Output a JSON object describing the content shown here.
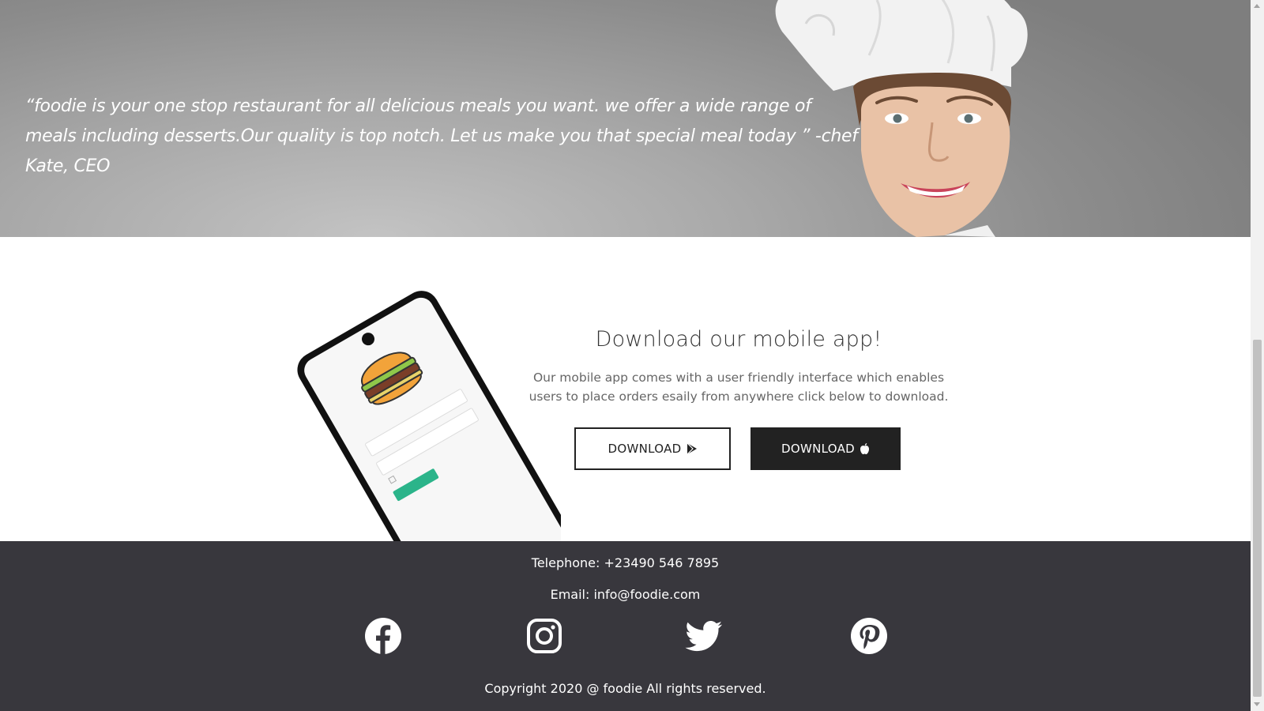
{
  "hero": {
    "quote": "“foodie is your one stop restaurant for all delicious meals you want. we offer a wide range of meals including desserts.Our quality is top notch. Let us make you that special meal today ” -chef Kate, CEO",
    "image": "chef-portrait"
  },
  "app": {
    "title": "Download our mobile app!",
    "description": "Our mobile app comes with a user friendly interface which enables users to place orders esaily from anywhere click below to download.",
    "phone_image": "phone-login-screen",
    "buttons": {
      "play_label": "DOWNLOAD",
      "play_icon": "google-play-icon",
      "apple_label": "DOWNLOAD",
      "apple_icon": "apple-icon"
    }
  },
  "footer": {
    "telephone": "Telephone: +23490 546 7895",
    "email": "Email: info@foodie.com",
    "social_icons": [
      "facebook-icon",
      "instagram-icon",
      "twitter-icon",
      "pinterest-icon"
    ],
    "copyright": "Copyright 2020 @ foodie All rights reserved."
  },
  "colors": {
    "footer_bg": "#38373d",
    "button_dark": "#222222",
    "login_button": "#2bb48a",
    "text_gray": "#666666"
  }
}
